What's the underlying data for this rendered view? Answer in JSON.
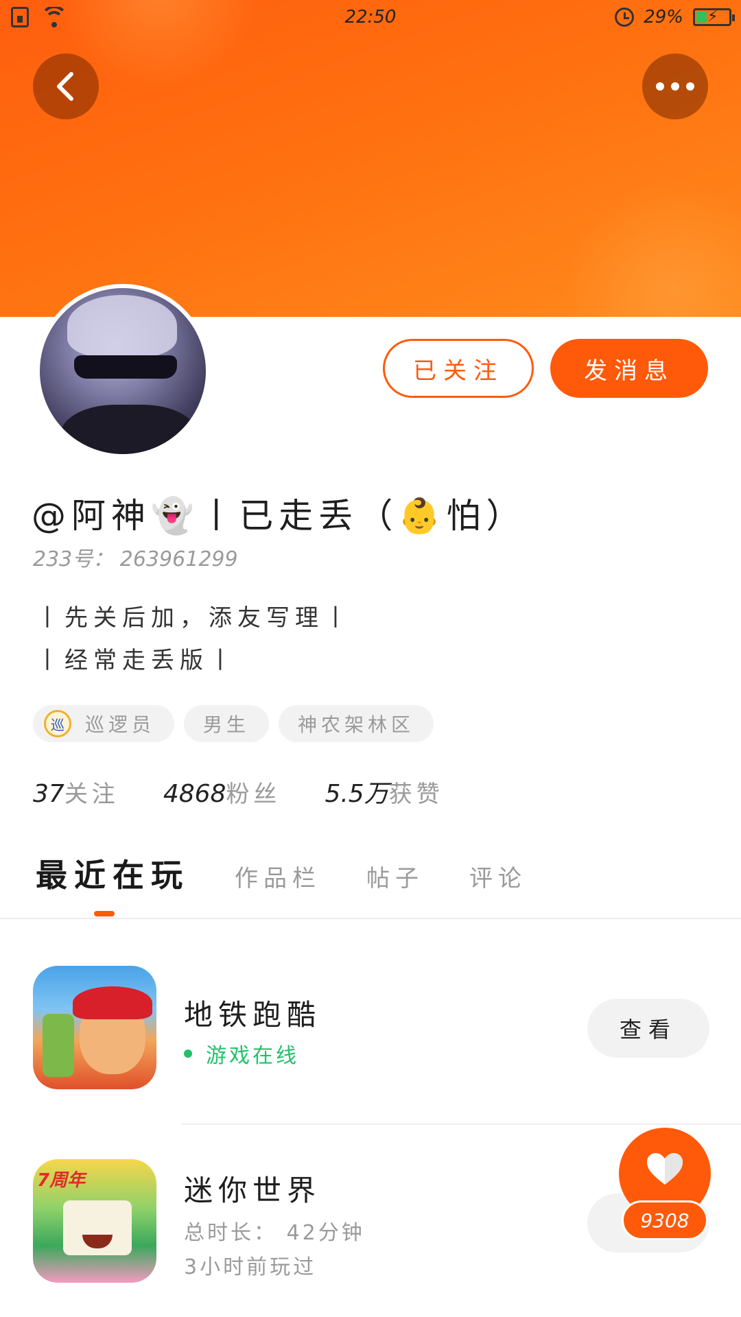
{
  "status_bar": {
    "time": "22:50",
    "battery_percent": "29%",
    "battery_level": 0.29
  },
  "profile": {
    "nickname": "@阿神👻丨已走丢（👶怕）",
    "uid": "233号： 263961299",
    "bio_lines": [
      "丨先关后加，添友写理丨",
      "丨经常走丢版丨"
    ],
    "follow_button": "已关注",
    "message_button": "发消息",
    "tags": [
      {
        "badge": "巡",
        "label": "巡逻员"
      },
      {
        "label": "男生"
      },
      {
        "label": "神农架林区"
      }
    ],
    "stats": [
      {
        "value": "37",
        "label": "关注"
      },
      {
        "value": "4868",
        "label": "粉丝"
      },
      {
        "value": "5.5万",
        "label": "获赞"
      }
    ]
  },
  "tabs": [
    {
      "label": "最近在玩",
      "active": true
    },
    {
      "label": "作品栏"
    },
    {
      "label": "帖子"
    },
    {
      "label": "评论"
    }
  ],
  "games": [
    {
      "title": "地铁跑酷",
      "status": "游戏在线",
      "action": "查看",
      "icon": "subway-surfers-icon"
    },
    {
      "title": "迷你世界",
      "icon_badge": "7周年",
      "duration": "总时长： 42分钟",
      "last_played": "3小时前玩过",
      "icon": "mini-world-icon"
    }
  ],
  "like": {
    "count": "9308"
  },
  "colors": {
    "accent": "#ff5a0a",
    "online": "#21c16b",
    "header_start": "#ff5e0e",
    "header_end": "#ff8a1c"
  }
}
